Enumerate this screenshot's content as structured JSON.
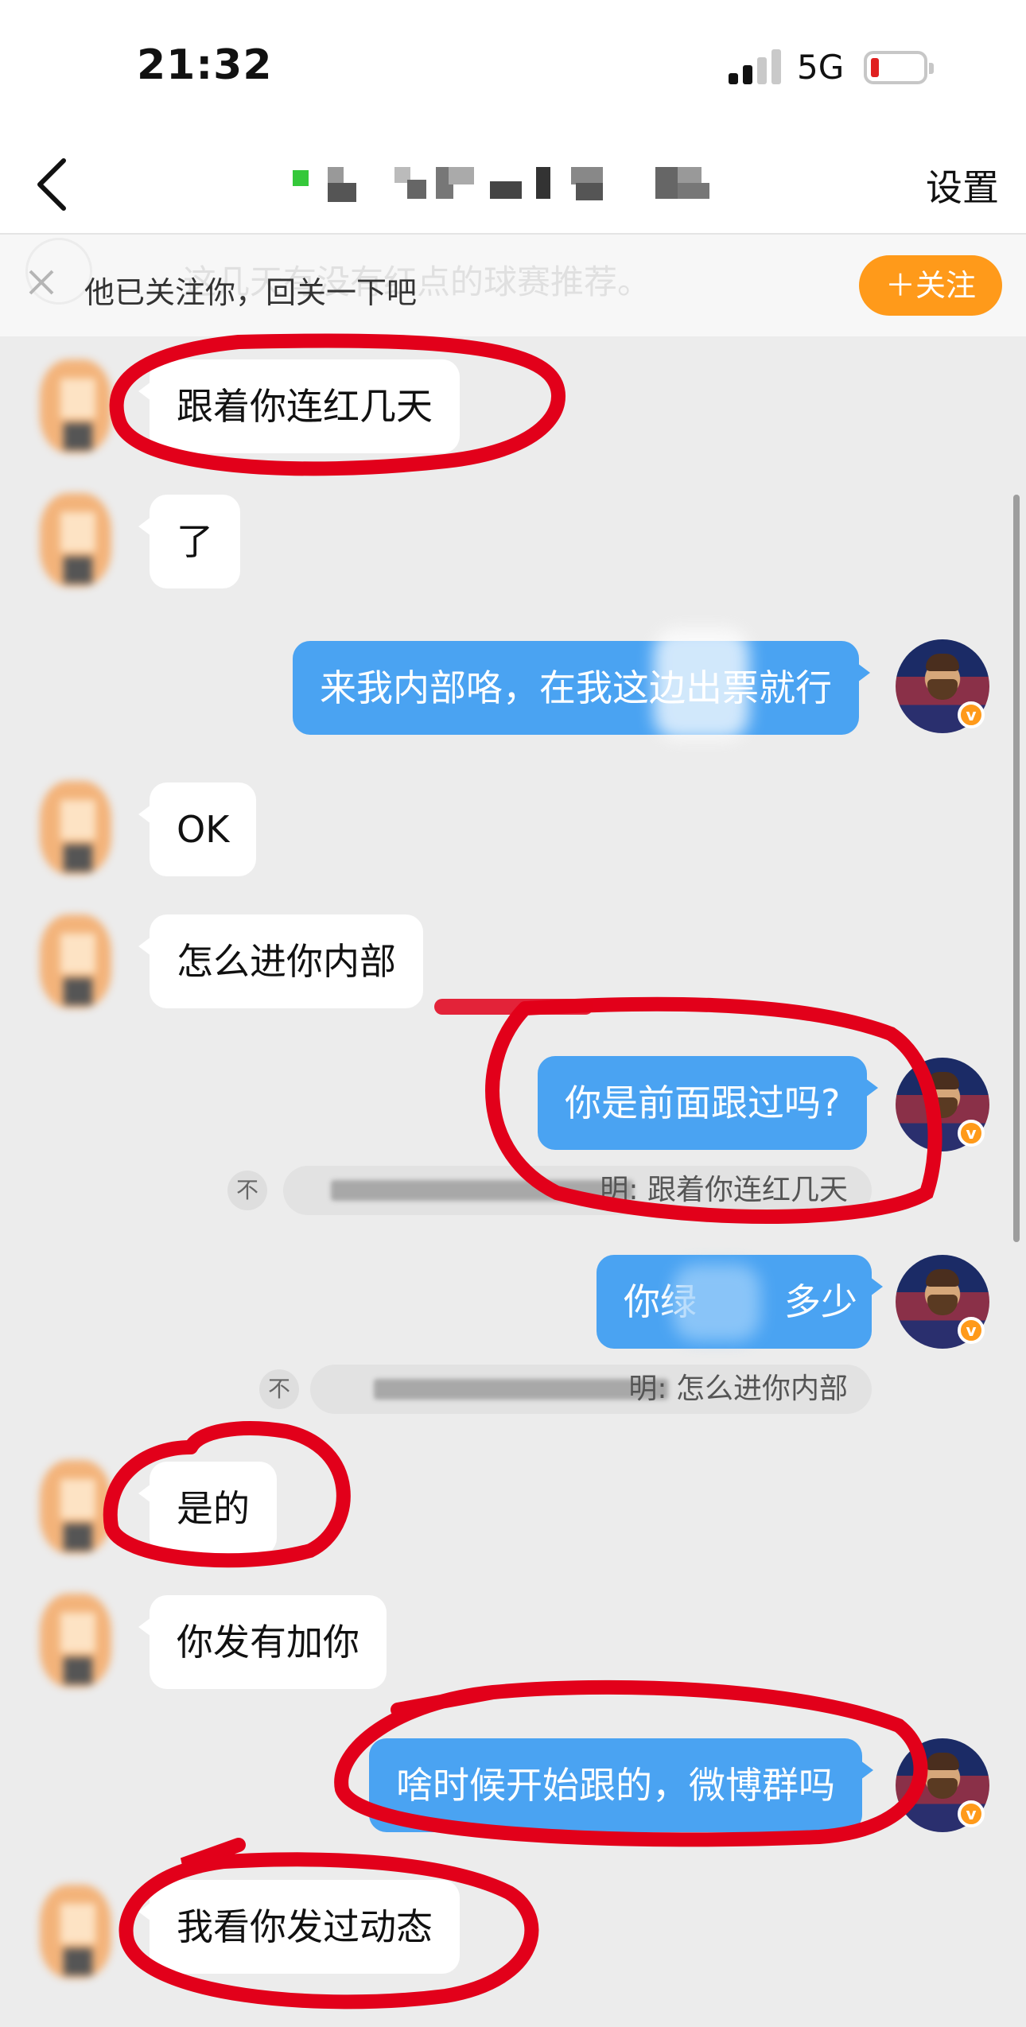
{
  "status_bar": {
    "time": "21:32",
    "network": "5G",
    "battery_level": 0.1,
    "battery_color": "#e02020"
  },
  "nav": {
    "back_icon": "chevron-left-icon",
    "title_redacted": true,
    "settings_label": "设置"
  },
  "follow_banner": {
    "close_icon": "close-icon",
    "text": "他已关注你，回关一下吧",
    "follow_label": "＋关注",
    "ghost_text": "这几天有没有红点的球赛推荐。",
    "accent_color": "#ff9a1a"
  },
  "messages": [
    {
      "side": "left",
      "text": "跟着你连红几天",
      "circled": true
    },
    {
      "side": "left",
      "text": "了"
    },
    {
      "side": "right",
      "text": "来我内部咯，在我这边出票就行"
    },
    {
      "side": "left",
      "text": "OK"
    },
    {
      "side": "left",
      "text": "怎么进你内部"
    },
    {
      "side": "right",
      "text": "你是前面跟过吗?",
      "circled": true,
      "quote": "跟着你连红几天",
      "quote_prefix": "明: "
    },
    {
      "side": "right",
      "text": "你绿",
      "text_after_blur": "多少",
      "quote": "怎么进你内部",
      "quote_prefix": "明: "
    },
    {
      "side": "left",
      "text": "是的",
      "circled": true
    },
    {
      "side": "left",
      "text": "你发有加你"
    },
    {
      "side": "right",
      "text": "啥时候开始跟的，微博群吗",
      "circled": true
    },
    {
      "side": "left",
      "text": "我看你发过动态",
      "circled": true
    }
  ],
  "unlike_label": "不",
  "colors": {
    "sent_bubble": "#4aa3f2",
    "received_bubble": "#ffffff",
    "background": "#ececec",
    "annotation_red": "#e2001a",
    "online": "#35c83a"
  }
}
